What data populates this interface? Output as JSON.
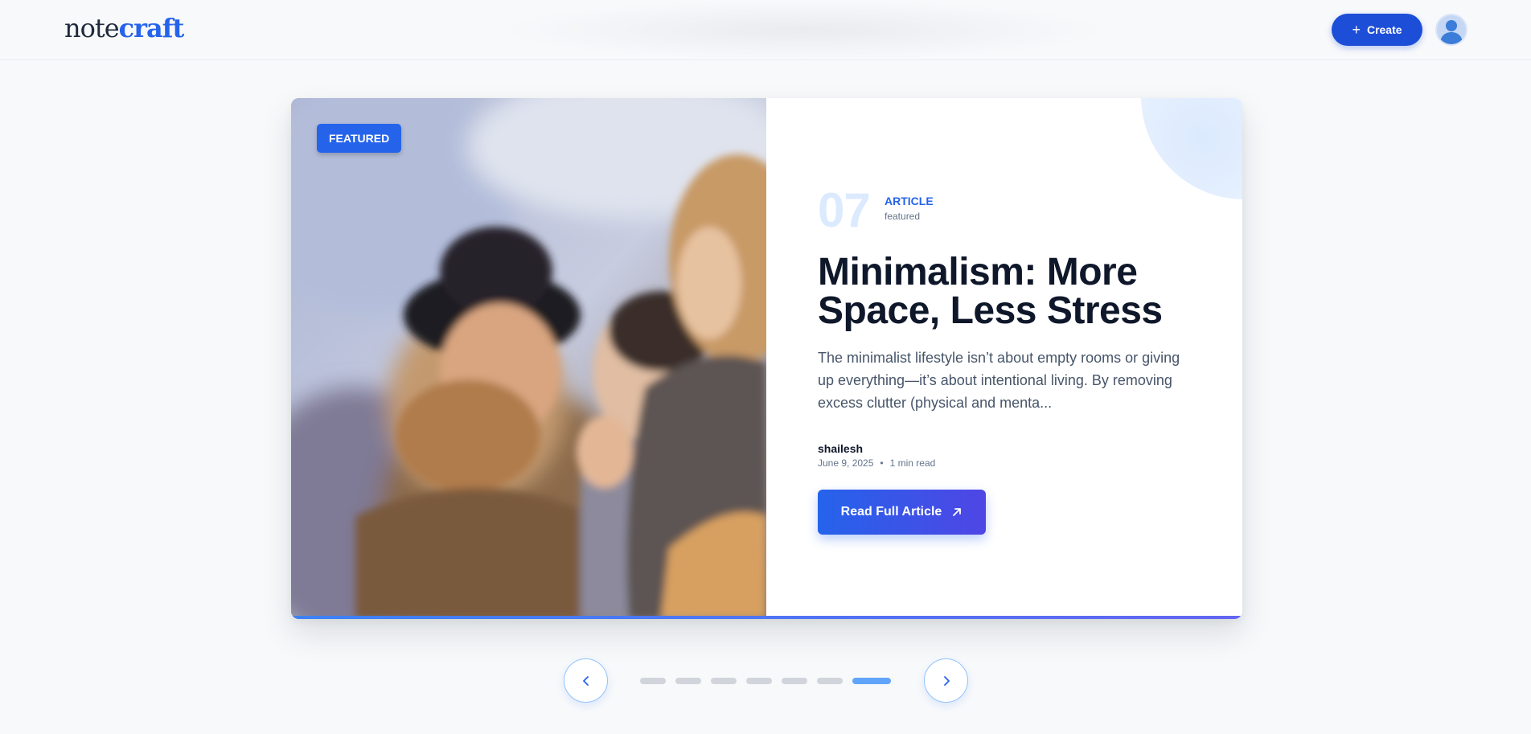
{
  "header": {
    "logo_part1": "note",
    "logo_part2": "craft",
    "create_label": "Create",
    "colors": {
      "brand": "#2563eb",
      "create_button": "#1d4ed8"
    }
  },
  "featured": {
    "badge": "FEATURED",
    "number": "07",
    "type": "ARTICLE",
    "type_sub": "featured",
    "title": "Minimalism: More Space, Less Stress",
    "excerpt": "The minimalist lifestyle isn’t about empty rooms or giving up everything—it’s about intentional living. By removing excess clutter (physical and menta...",
    "author": "shailesh",
    "date": "June 9, 2025",
    "separator": "•",
    "read_time": "1 min read",
    "cta": "Read Full Article",
    "cta_icon": "arrow-up-right-icon",
    "image_icon": "photo-of-three-laughing-women"
  },
  "carousel": {
    "prev_icon": "chevron-left-icon",
    "next_icon": "chevron-right-icon",
    "total_slides": 7,
    "active_slide": 7,
    "colors": {
      "dot": "#d1d5db",
      "dot_active": "#60a5fa"
    }
  }
}
